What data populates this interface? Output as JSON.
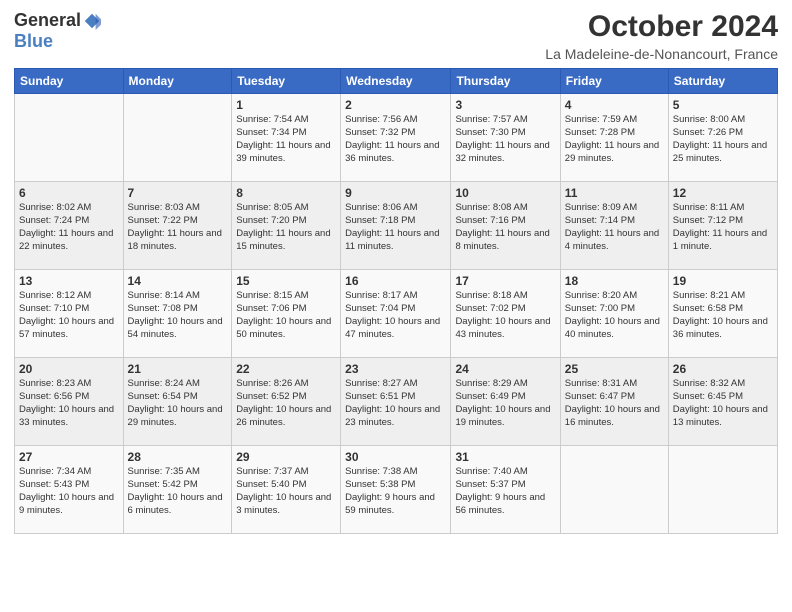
{
  "logo": {
    "general": "General",
    "blue": "Blue"
  },
  "title": "October 2024",
  "location": "La Madeleine-de-Nonancourt, France",
  "days_of_week": [
    "Sunday",
    "Monday",
    "Tuesday",
    "Wednesday",
    "Thursday",
    "Friday",
    "Saturday"
  ],
  "weeks": [
    [
      {
        "day": "",
        "info": ""
      },
      {
        "day": "",
        "info": ""
      },
      {
        "day": "1",
        "info": "Sunrise: 7:54 AM\nSunset: 7:34 PM\nDaylight: 11 hours and 39 minutes."
      },
      {
        "day": "2",
        "info": "Sunrise: 7:56 AM\nSunset: 7:32 PM\nDaylight: 11 hours and 36 minutes."
      },
      {
        "day": "3",
        "info": "Sunrise: 7:57 AM\nSunset: 7:30 PM\nDaylight: 11 hours and 32 minutes."
      },
      {
        "day": "4",
        "info": "Sunrise: 7:59 AM\nSunset: 7:28 PM\nDaylight: 11 hours and 29 minutes."
      },
      {
        "day": "5",
        "info": "Sunrise: 8:00 AM\nSunset: 7:26 PM\nDaylight: 11 hours and 25 minutes."
      }
    ],
    [
      {
        "day": "6",
        "info": "Sunrise: 8:02 AM\nSunset: 7:24 PM\nDaylight: 11 hours and 22 minutes."
      },
      {
        "day": "7",
        "info": "Sunrise: 8:03 AM\nSunset: 7:22 PM\nDaylight: 11 hours and 18 minutes."
      },
      {
        "day": "8",
        "info": "Sunrise: 8:05 AM\nSunset: 7:20 PM\nDaylight: 11 hours and 15 minutes."
      },
      {
        "day": "9",
        "info": "Sunrise: 8:06 AM\nSunset: 7:18 PM\nDaylight: 11 hours and 11 minutes."
      },
      {
        "day": "10",
        "info": "Sunrise: 8:08 AM\nSunset: 7:16 PM\nDaylight: 11 hours and 8 minutes."
      },
      {
        "day": "11",
        "info": "Sunrise: 8:09 AM\nSunset: 7:14 PM\nDaylight: 11 hours and 4 minutes."
      },
      {
        "day": "12",
        "info": "Sunrise: 8:11 AM\nSunset: 7:12 PM\nDaylight: 11 hours and 1 minute."
      }
    ],
    [
      {
        "day": "13",
        "info": "Sunrise: 8:12 AM\nSunset: 7:10 PM\nDaylight: 10 hours and 57 minutes."
      },
      {
        "day": "14",
        "info": "Sunrise: 8:14 AM\nSunset: 7:08 PM\nDaylight: 10 hours and 54 minutes."
      },
      {
        "day": "15",
        "info": "Sunrise: 8:15 AM\nSunset: 7:06 PM\nDaylight: 10 hours and 50 minutes."
      },
      {
        "day": "16",
        "info": "Sunrise: 8:17 AM\nSunset: 7:04 PM\nDaylight: 10 hours and 47 minutes."
      },
      {
        "day": "17",
        "info": "Sunrise: 8:18 AM\nSunset: 7:02 PM\nDaylight: 10 hours and 43 minutes."
      },
      {
        "day": "18",
        "info": "Sunrise: 8:20 AM\nSunset: 7:00 PM\nDaylight: 10 hours and 40 minutes."
      },
      {
        "day": "19",
        "info": "Sunrise: 8:21 AM\nSunset: 6:58 PM\nDaylight: 10 hours and 36 minutes."
      }
    ],
    [
      {
        "day": "20",
        "info": "Sunrise: 8:23 AM\nSunset: 6:56 PM\nDaylight: 10 hours and 33 minutes."
      },
      {
        "day": "21",
        "info": "Sunrise: 8:24 AM\nSunset: 6:54 PM\nDaylight: 10 hours and 29 minutes."
      },
      {
        "day": "22",
        "info": "Sunrise: 8:26 AM\nSunset: 6:52 PM\nDaylight: 10 hours and 26 minutes."
      },
      {
        "day": "23",
        "info": "Sunrise: 8:27 AM\nSunset: 6:51 PM\nDaylight: 10 hours and 23 minutes."
      },
      {
        "day": "24",
        "info": "Sunrise: 8:29 AM\nSunset: 6:49 PM\nDaylight: 10 hours and 19 minutes."
      },
      {
        "day": "25",
        "info": "Sunrise: 8:31 AM\nSunset: 6:47 PM\nDaylight: 10 hours and 16 minutes."
      },
      {
        "day": "26",
        "info": "Sunrise: 8:32 AM\nSunset: 6:45 PM\nDaylight: 10 hours and 13 minutes."
      }
    ],
    [
      {
        "day": "27",
        "info": "Sunrise: 7:34 AM\nSunset: 5:43 PM\nDaylight: 10 hours and 9 minutes."
      },
      {
        "day": "28",
        "info": "Sunrise: 7:35 AM\nSunset: 5:42 PM\nDaylight: 10 hours and 6 minutes."
      },
      {
        "day": "29",
        "info": "Sunrise: 7:37 AM\nSunset: 5:40 PM\nDaylight: 10 hours and 3 minutes."
      },
      {
        "day": "30",
        "info": "Sunrise: 7:38 AM\nSunset: 5:38 PM\nDaylight: 9 hours and 59 minutes."
      },
      {
        "day": "31",
        "info": "Sunrise: 7:40 AM\nSunset: 5:37 PM\nDaylight: 9 hours and 56 minutes."
      },
      {
        "day": "",
        "info": ""
      },
      {
        "day": "",
        "info": ""
      }
    ]
  ]
}
